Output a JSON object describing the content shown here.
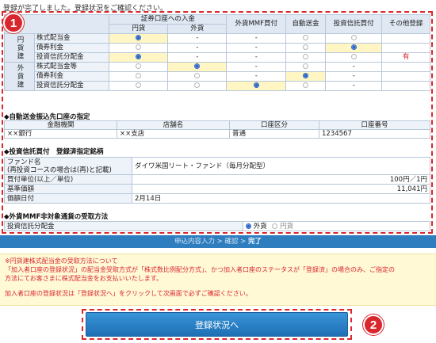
{
  "intro": "登録が完了しました。登録状況をご確認ください。",
  "badges": {
    "one": "1",
    "two": "2"
  },
  "matrix": {
    "head_securities": "証券口座への入金",
    "head_yen": "円貨",
    "head_foreign": "外貨",
    "head_mmf": "外貨MMF買付",
    "head_auto": "自動送金",
    "head_trust": "投資信託買付",
    "head_other": "その他登録",
    "group_yen": "円貨建",
    "group_foreign": "外貨建",
    "rows": [
      {
        "label": "株式配当金",
        "yen": "on",
        "foreign": "-",
        "mmf": "-",
        "auto": "off",
        "trust": "off",
        "other": ""
      },
      {
        "label": "債券利金",
        "yen": "off",
        "foreign": "-",
        "mmf": "-",
        "auto": "off",
        "trust": "on",
        "other": ""
      },
      {
        "label": "投資信託分配金",
        "yen": "on",
        "foreign": "-",
        "mmf": "-",
        "auto": "off",
        "trust": "off",
        "other": "有"
      },
      {
        "label": "株式配当金等",
        "yen": "off",
        "foreign": "on",
        "mmf": "-",
        "auto": "off",
        "trust": "-",
        "other": ""
      },
      {
        "label": "債券利金",
        "yen": "off",
        "foreign": "off",
        "mmf": "-",
        "auto": "on",
        "trust": "-",
        "other": ""
      },
      {
        "label": "投資信託分配金",
        "yen": "off",
        "foreign": "off",
        "mmf": "on",
        "auto": "off",
        "trust": "-",
        "other": ""
      }
    ]
  },
  "auto_remit": {
    "title": "◆自動送金振込先口座の指定",
    "headers": [
      "金融機関",
      "店舗名",
      "口座区分",
      "口座番号"
    ],
    "values": [
      "××銀行",
      "××支店",
      "普通",
      "1234567"
    ]
  },
  "fund": {
    "title": "◆投資信託買付　登録済指定銘柄",
    "fund_label": "ファンド名\n(再投資コースの場合は(再)と記載)",
    "fund_label_1": "ファンド名",
    "fund_label_2": "(再投資コースの場合は(再)と記載)",
    "fund_value": "ダイワ米国リート・ファンド（毎月分配型）",
    "unit_label": "買付単位(以上／単位)",
    "unit_value": "100円／1円",
    "base_label": "基準価額",
    "base_value": "11,041円",
    "date_label": "価額日付",
    "date_value": "2月14日"
  },
  "mmf": {
    "title": "◆外貨MMF非対象通貨の受取方法",
    "label": "投資信託分配金",
    "opt_foreign": "外貨",
    "opt_yen": "円貨"
  },
  "steps": {
    "prefix": "申込内容入力 > 確認 > ",
    "current": "完了"
  },
  "note": {
    "line1": "※円貨建株式配当金の受取方法について",
    "line2": "「加入者口座の登録状況」の配当金受取方式が「株式数比例配分方式」、かつ加入者口座のステータスが「登録済」の場合のみ、ご指定の",
    "line3": "方法にてお客さまに株式配当金をお支払いいたします。",
    "line4": "加入者口座の登録状況は「登録状況へ」をクリックして次画面で必ずご確認ください。"
  },
  "button": "登録状況へ",
  "colors": {
    "accent": "#d9272e",
    "primary": "#2e7dbf",
    "highlight": "#fff6c4"
  }
}
